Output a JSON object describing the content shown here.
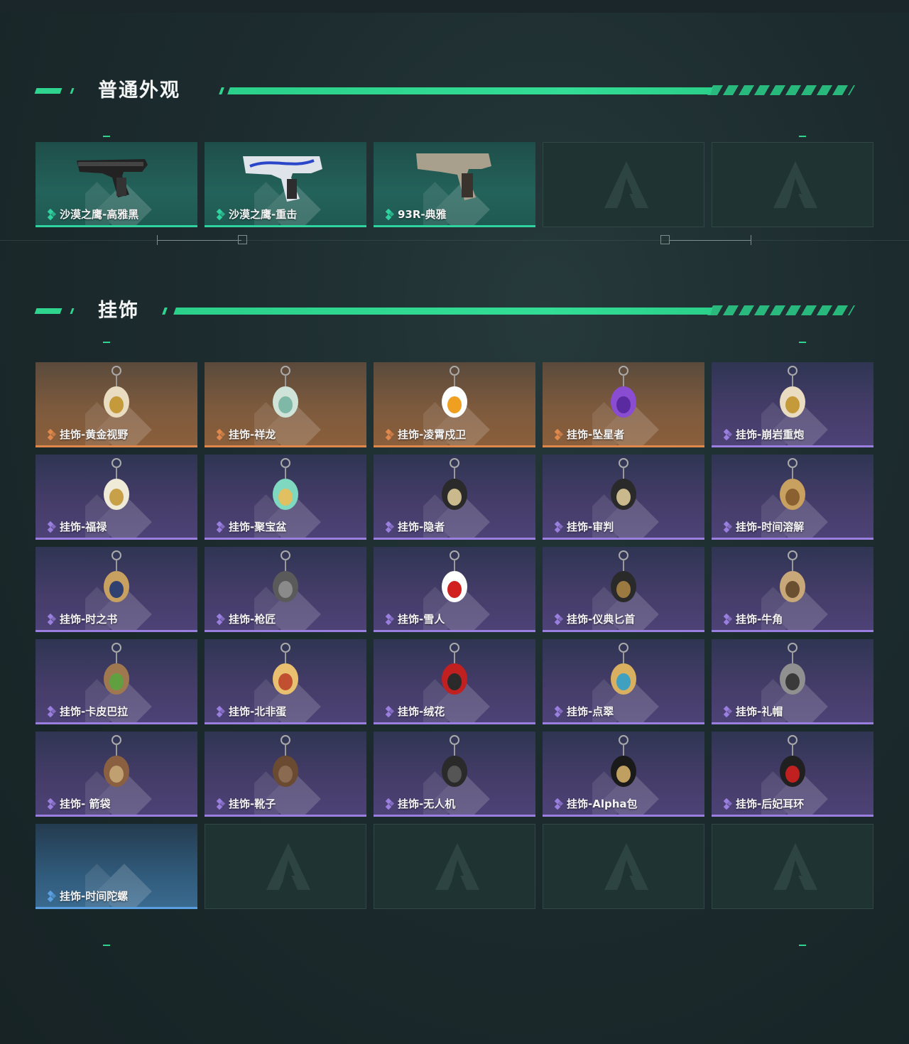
{
  "sections": [
    {
      "title": "普通外观",
      "items": [
        {
          "label": "沙漠之鹰-高雅黑",
          "rarity": "green",
          "icon": "pistol-black-icon"
        },
        {
          "label": "沙漠之鹰-重击",
          "rarity": "green",
          "icon": "pistol-white-blue-icon"
        },
        {
          "label": "93R-典雅",
          "rarity": "green",
          "icon": "pistol-tan-icon"
        },
        {
          "label": "",
          "rarity": "empty",
          "icon": "placeholder-logo-icon"
        },
        {
          "label": "",
          "rarity": "empty",
          "icon": "placeholder-logo-icon"
        }
      ]
    },
    {
      "title": "挂饰",
      "items": [
        {
          "label": "挂饰-黄金视野",
          "rarity": "orange",
          "icon": "charm-figure-icon"
        },
        {
          "label": "挂饰-祥龙",
          "rarity": "orange",
          "icon": "charm-dragon-icon"
        },
        {
          "label": "挂饰-凌霄戍卫",
          "rarity": "orange",
          "icon": "charm-guard-icon"
        },
        {
          "label": "挂饰-坠星者",
          "rarity": "orange",
          "icon": "charm-crystal-icon"
        },
        {
          "label": "挂饰-崩岩重炮",
          "rarity": "purple",
          "icon": "charm-figure-icon"
        },
        {
          "label": "挂饰-福禄",
          "rarity": "purple",
          "icon": "charm-gourd-icon"
        },
        {
          "label": "挂饰-聚宝盆",
          "rarity": "purple",
          "icon": "charm-bowl-icon"
        },
        {
          "label": "挂饰-隐者",
          "rarity": "purple",
          "icon": "charm-card-icon"
        },
        {
          "label": "挂饰-审判",
          "rarity": "purple",
          "icon": "charm-card-icon"
        },
        {
          "label": "挂饰-时间溶解",
          "rarity": "purple",
          "icon": "charm-clock-icon"
        },
        {
          "label": "挂饰-时之书",
          "rarity": "purple",
          "icon": "charm-book-icon"
        },
        {
          "label": "挂饰-枪匠",
          "rarity": "purple",
          "icon": "charm-case-icon"
        },
        {
          "label": "挂饰-雪人",
          "rarity": "purple",
          "icon": "charm-snowman-icon"
        },
        {
          "label": "挂饰-仪典匕首",
          "rarity": "purple",
          "icon": "charm-dagger-icon"
        },
        {
          "label": "挂饰-牛角",
          "rarity": "purple",
          "icon": "charm-horn-icon"
        },
        {
          "label": "挂饰-卡皮巴拉",
          "rarity": "purple",
          "icon": "charm-capybara-icon"
        },
        {
          "label": "挂饰-北非蛋",
          "rarity": "purple",
          "icon": "charm-pan-icon"
        },
        {
          "label": "挂饰-绒花",
          "rarity": "purple",
          "icon": "charm-flower-icon"
        },
        {
          "label": "挂饰-点翠",
          "rarity": "purple",
          "icon": "charm-ornament-icon"
        },
        {
          "label": "挂饰-礼帽",
          "rarity": "purple",
          "icon": "charm-hat-icon"
        },
        {
          "label": "挂饰- 箭袋",
          "rarity": "purple",
          "icon": "charm-quiver-icon"
        },
        {
          "label": "挂饰-靴子",
          "rarity": "purple",
          "icon": "charm-boot-icon"
        },
        {
          "label": "挂饰-无人机",
          "rarity": "purple",
          "icon": "charm-drone-icon"
        },
        {
          "label": "挂饰-Alpha包",
          "rarity": "purple",
          "icon": "charm-bag-icon"
        },
        {
          "label": "挂饰-后妃耳环",
          "rarity": "purple",
          "icon": "charm-earring-icon"
        },
        {
          "label": "挂饰-时间陀螺",
          "rarity": "blue",
          "icon": "charm-none"
        },
        {
          "label": "",
          "rarity": "empty",
          "icon": "placeholder-logo-icon"
        },
        {
          "label": "",
          "rarity": "empty",
          "icon": "placeholder-logo-icon"
        },
        {
          "label": "",
          "rarity": "empty",
          "icon": "placeholder-logo-icon"
        },
        {
          "label": "",
          "rarity": "empty",
          "icon": "placeholder-logo-icon"
        }
      ]
    }
  ],
  "colors": {
    "accent": "#2fd58f",
    "green": "#2fd3a0",
    "orange": "#e0874b",
    "purple": "#9a7fe0",
    "blue": "#5aa0e0"
  }
}
